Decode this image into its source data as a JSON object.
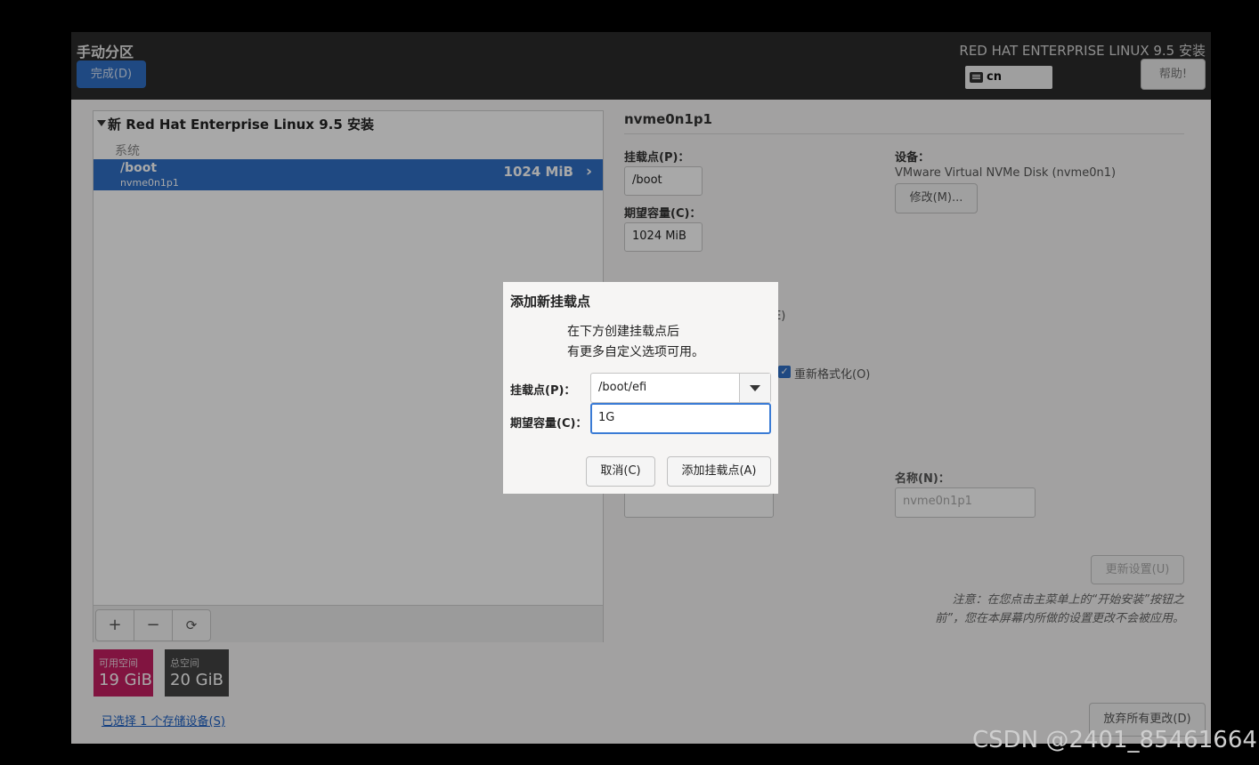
{
  "header": {
    "title": "手动分区",
    "done_label": "完成(D)",
    "product_title": "RED HAT ENTERPRISE LINUX 9.5 安装",
    "keyboard_layout": "cn",
    "help_label": "帮助!"
  },
  "left_panel": {
    "tree_title": "新 Red Hat Enterprise Linux 9.5 安装",
    "section_label": "系统",
    "selected_partition": {
      "mount_point": "/boot",
      "device": "nvme0n1p1",
      "size": "1024 MiB"
    },
    "toolbar": {
      "add": "+",
      "remove": "−",
      "refresh": "⟳"
    }
  },
  "space": {
    "available_label": "可用空间",
    "available_value": "19 GiB",
    "total_label": "总空间",
    "total_value": "20 GiB"
  },
  "storage_link": "已选择 1 个存储设备(S)",
  "right_panel": {
    "title": "nvme0n1p1",
    "mount_point_label": "挂载点(P)：",
    "mount_point_value": "/boot",
    "desired_capacity_label": "期望容量(C)：",
    "desired_capacity_value": "1024 MiB",
    "device_label": "设备：",
    "device_value": "VMware Virtual NVMe Disk (nvme0n1)",
    "modify_label": "修改(M)...",
    "encrypt_fragment": "(E)",
    "reformat_label": "重新格式化(O)",
    "name_label": "名称(N)：",
    "name_value": "nvme0n1p1",
    "update_label": "更新设置(U)",
    "note": "注意：在您点击主菜单上的“开始安装”按钮之前”，您在本屏幕内所做的设置更改不会被应用。",
    "discard_label": "放弃所有更改(D)"
  },
  "dialog": {
    "title": "添加新挂载点",
    "desc_line1": "在下方创建挂载点后",
    "desc_line2": "有更多自定义选项可用。",
    "mount_point_label": "挂载点(P)：",
    "mount_point_value": "/boot/efi",
    "capacity_label": "期望容量(C)：",
    "capacity_value": "1G",
    "cancel_label": "取消(C)",
    "add_label": "添加挂载点(A)"
  },
  "watermark": "CSDN @2401_85461664"
}
